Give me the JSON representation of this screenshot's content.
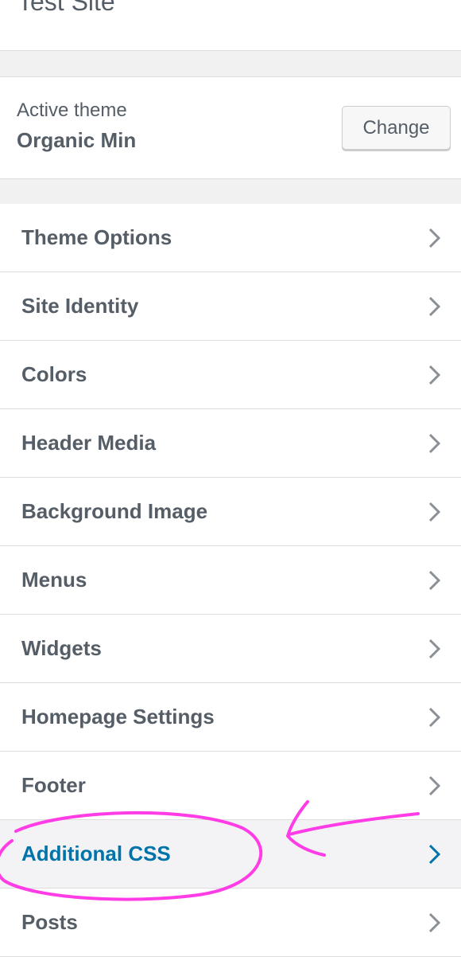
{
  "site_title": "Test Site",
  "theme": {
    "active_label": "Active theme",
    "name": "Organic Min",
    "change_label": "Change"
  },
  "menu": [
    {
      "label": "Theme Options"
    },
    {
      "label": "Site Identity"
    },
    {
      "label": "Colors"
    },
    {
      "label": "Header Media"
    },
    {
      "label": "Background Image"
    },
    {
      "label": "Menus"
    },
    {
      "label": "Widgets"
    },
    {
      "label": "Homepage Settings"
    },
    {
      "label": "Footer"
    },
    {
      "label": "Additional CSS",
      "highlighted": true
    },
    {
      "label": "Posts"
    }
  ],
  "icons": {
    "menu_item": "chevron-right-icon"
  },
  "colors": {
    "text": "#555d66",
    "accent": "#0073aa",
    "annotation": "#ff3ce6",
    "panel_background": "#f1f1f1"
  }
}
